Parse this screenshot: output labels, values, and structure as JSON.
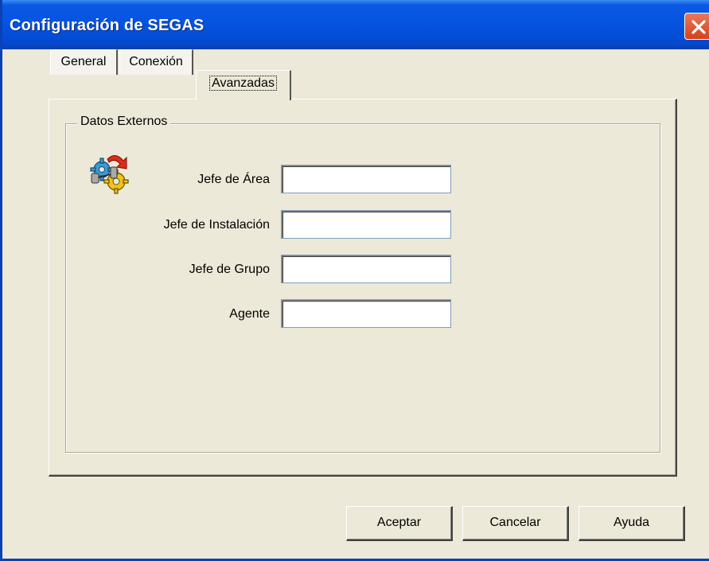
{
  "window": {
    "title": "Configuración de SEGAS"
  },
  "tabs": [
    {
      "label": "General",
      "active": false
    },
    {
      "label": "Conexión",
      "active": false
    },
    {
      "label": "Avanzadas",
      "active": true
    }
  ],
  "group": {
    "label": "Datos Externos",
    "icon": "gears-database-icon",
    "fields": [
      {
        "label": "Jefe de Área",
        "value": ""
      },
      {
        "label": "Jefe de Instalación",
        "value": ""
      },
      {
        "label": "Jefe de Grupo",
        "value": ""
      },
      {
        "label": "Agente",
        "value": ""
      }
    ]
  },
  "buttons": {
    "ok": "Aceptar",
    "cancel": "Cancelar",
    "help": "Ayuda"
  },
  "colors": {
    "titlebar": "#0553df",
    "face": "#ece9d8",
    "close": "#d5411b"
  }
}
